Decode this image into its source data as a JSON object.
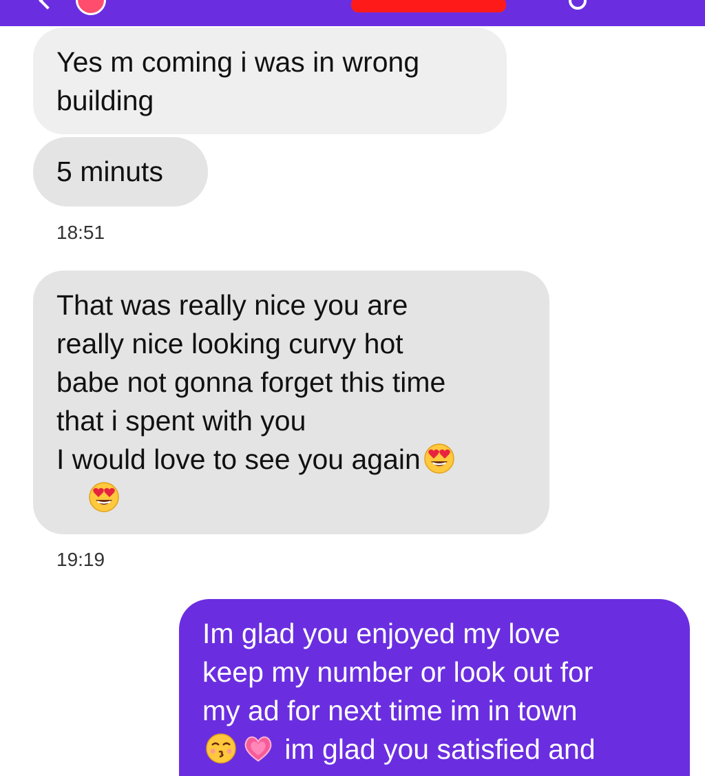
{
  "messages": [
    {
      "direction": "incoming",
      "text": "Yes m coming i was in wrong\nbuilding"
    },
    {
      "direction": "incoming",
      "text": "5 minuts"
    },
    {
      "direction": "incoming",
      "text": "That was really nice you are\nreally nice looking curvy hot\nbabe not gonna forget this time\nthat i spent with you\nI would love to see you again",
      "emojis": [
        "heart-eyes-face",
        "heart-eyes-face"
      ]
    },
    {
      "direction": "outgoing",
      "text_before": "Im glad you enjoyed my love\nkeep my number or look out for\nmy ad for next time im in town\n",
      "emojis": [
        "kissing-face",
        "growing-heart"
      ],
      "text_after": "im glad you satisfied and"
    }
  ],
  "timestamps": [
    "18:51",
    "19:19"
  ],
  "colors": {
    "accent": "#6a2ee0",
    "incoming_bubble": "#e4e4e4",
    "redaction": "#ff1a1a"
  }
}
